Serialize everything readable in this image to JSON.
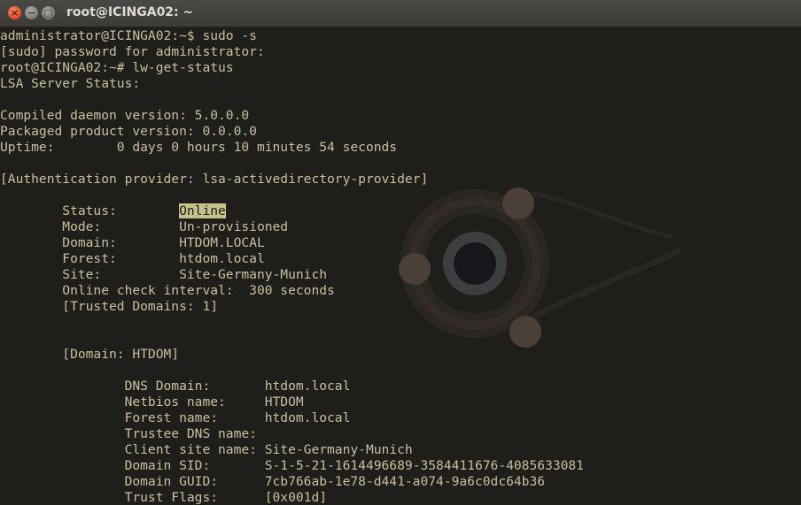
{
  "window": {
    "title": "root@ICINGA02: ~",
    "buttons": {
      "close": "×",
      "minimize": "−",
      "maximize": "□"
    }
  },
  "terminal": {
    "lines": [
      "administrator@ICINGA02:~$ sudo -s",
      "[sudo] password for administrator:",
      "root@ICINGA02:~# lw-get-status",
      "LSA Server Status:",
      "",
      "Compiled daemon version: 5.0.0.0",
      "Packaged product version: 0.0.0.0",
      "Uptime:        0 days 0 hours 10 minutes 54 seconds",
      "",
      "[Authentication provider: lsa-activedirectory-provider]",
      "",
      "        Status:        ",
      "        Mode:          Un-provisioned",
      "        Domain:        HTDOM.LOCAL",
      "        Forest:        htdom.local",
      "        Site:          Site-Germany-Munich",
      "        Online check interval:  300 seconds",
      "        [Trusted Domains: 1]",
      "",
      "",
      "        [Domain: HTDOM]",
      "",
      "                DNS Domain:       htdom.local",
      "                Netbios name:     HTDOM",
      "                Forest name:      htdom.local",
      "                Trustee DNS name:",
      "                Client site name: Site-Germany-Munich",
      "                Domain SID:       S-1-5-21-1614496689-3584411676-4085633081",
      "                Domain GUID:      7cb766ab-1e78-d441-a074-9a6c0dc64b36",
      "                Trust Flags:      [0x001d]"
    ],
    "highlighted_value": "Online",
    "highlight_color": "#c5c28a",
    "text_color": "#c9c0a0",
    "background_color": "#1f1e1b"
  }
}
